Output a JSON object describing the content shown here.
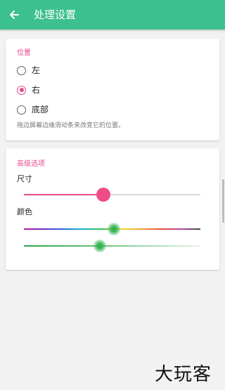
{
  "app_bar": {
    "title": "处理设置",
    "back_icon": "arrow-left-icon",
    "color": "#3cc08f"
  },
  "position_section": {
    "title": "位置",
    "options": [
      {
        "label": "左",
        "selected": false
      },
      {
        "label": "右",
        "selected": true
      },
      {
        "label": "底部",
        "selected": false
      }
    ],
    "hint": "拖边屏幕边缘滑动条来改变它的位置。"
  },
  "advanced_section": {
    "title": "高级选项",
    "size_label": "尺寸",
    "size_value": 0.45,
    "color_label": "颜色",
    "hue_value": 0.51,
    "lightness_value": 0.43
  },
  "accent_color": "#e84a8b",
  "watermark": "大玩客"
}
